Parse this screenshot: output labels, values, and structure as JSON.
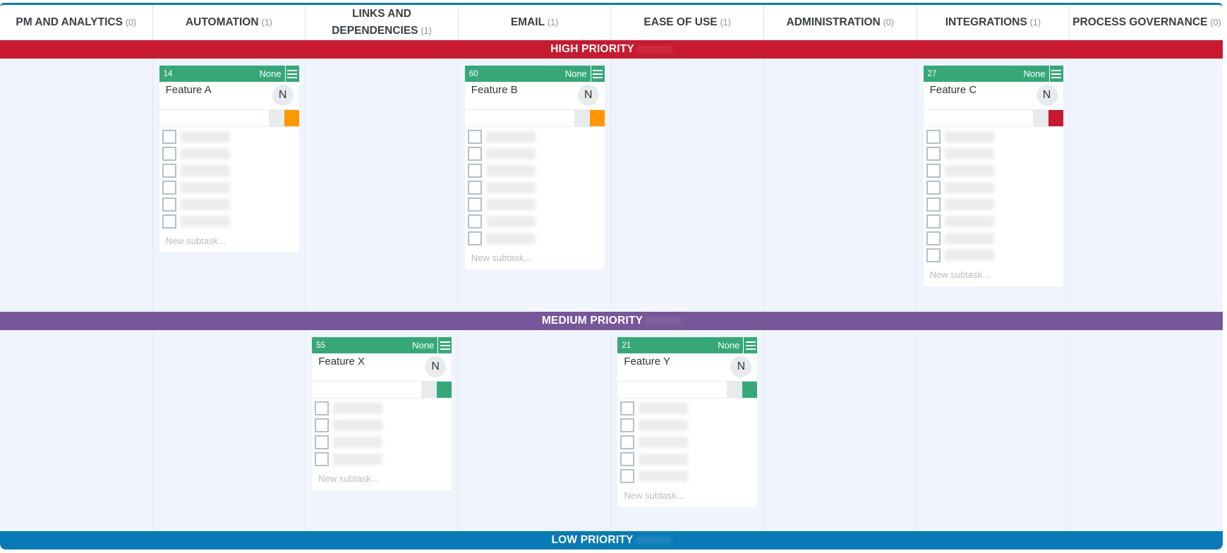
{
  "columns": [
    {
      "title": "PM AND ANALYTICS",
      "count": "(0)"
    },
    {
      "title": "AUTOMATION",
      "count": "(1)"
    },
    {
      "title": "LINKS AND DEPENDENCIES",
      "count": "(1)"
    },
    {
      "title": "EMAIL",
      "count": "(1)"
    },
    {
      "title": "EASE OF USE",
      "count": "(1)"
    },
    {
      "title": "ADMINISTRATION",
      "count": "(0)"
    },
    {
      "title": "INTEGRATIONS",
      "count": "(1)"
    },
    {
      "title": "PROCESS GOVERNANCE",
      "count": "(0)"
    }
  ],
  "bands": {
    "high": {
      "label": "HIGH PRIORITY",
      "color": "#c9192f"
    },
    "medium": {
      "label": "MEDIUM PRIORITY",
      "color": "#77569a"
    },
    "low": {
      "label": "LOW PRIORITY",
      "color": "#087bb7"
    }
  },
  "cards": {
    "a": {
      "id": "14",
      "status": "None",
      "title": "Feature A",
      "avatar": "N",
      "tag_color": "#ff9800",
      "subtask_count": 6,
      "new_subtask_placeholder": "New subtask..."
    },
    "b": {
      "id": "60",
      "status": "None",
      "title": "Feature B",
      "avatar": "N",
      "tag_color": "#ff9800",
      "subtask_count": 7,
      "new_subtask_placeholder": "New subtask..."
    },
    "c": {
      "id": "27",
      "status": "None",
      "title": "Feature C",
      "avatar": "N",
      "tag_color": "#c9192f",
      "subtask_count": 8,
      "new_subtask_placeholder": "New subtask..."
    },
    "x": {
      "id": "55",
      "status": "None",
      "title": "Feature X",
      "avatar": "N",
      "tag_color": "#36a878",
      "subtask_count": 4,
      "new_subtask_placeholder": "New subtask..."
    },
    "y": {
      "id": "21",
      "status": "None",
      "title": "Feature Y",
      "avatar": "N",
      "tag_color": "#36a878",
      "subtask_count": 5,
      "new_subtask_placeholder": "New subtask..."
    }
  },
  "theme": {
    "card_header": "#36a878",
    "board_border": "#0a7ab8"
  }
}
